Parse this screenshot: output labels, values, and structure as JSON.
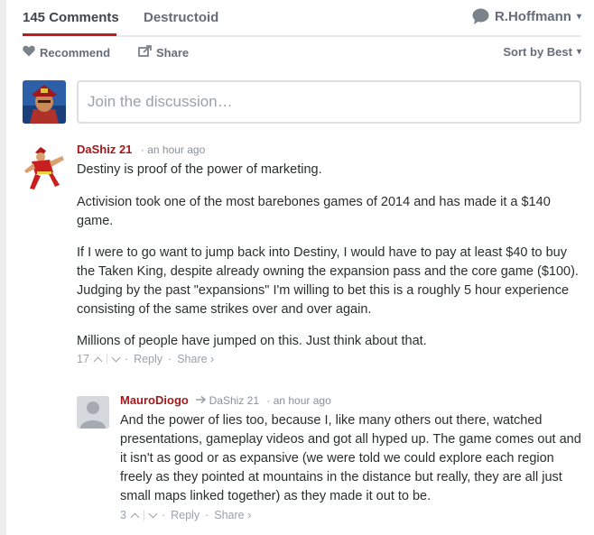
{
  "nav": {
    "comments_tab": "145 Comments",
    "site_tab": "Destructoid",
    "user_name": "R.Hoffmann",
    "caret": "▾"
  },
  "toolbar": {
    "recommend": "Recommend",
    "share": "Share",
    "sort": "Sort by Best",
    "caret": "▾"
  },
  "compose": {
    "placeholder": "Join the discussion…"
  },
  "comments": [
    {
      "author": "DaShiz 21",
      "time": "an hour ago",
      "paragraphs": [
        "Destiny is proof of the power of marketing.",
        "Activision took one of the most barebones games of 2014 and has made it a $140 game.",
        "If I were to go want to jump back into Destiny, I would have to pay at least $40 to buy the Taken King, despite already owning the expansion pass and the core game ($100). Judging by the past \"expansions\" I'm willing to bet this is a roughly 5 hour experience consisting of the same strikes over and over again.",
        "Millions of people have jumped on this. Just think about that."
      ],
      "votes": "17",
      "reply": "Reply",
      "share": "Share ›"
    },
    {
      "author": "MauroDiogo",
      "reply_to": "DaShiz 21",
      "time": "an hour ago",
      "text": "And the power of lies too, because I, like many others out there, watched presentations, gameplay videos and got all hyped up. The game comes out and it isn't as good or as expansive (we were told we could explore each region freely as they pointed at mountains in the distance but really, they are all just small maps linked together) as they made it out to be.",
      "votes": "3",
      "reply": "Reply",
      "share": "Share ›"
    }
  ],
  "colors": {
    "accent_red": "#a3181a",
    "tab_underline": "#c01a1a",
    "muted": "#656c7a"
  }
}
